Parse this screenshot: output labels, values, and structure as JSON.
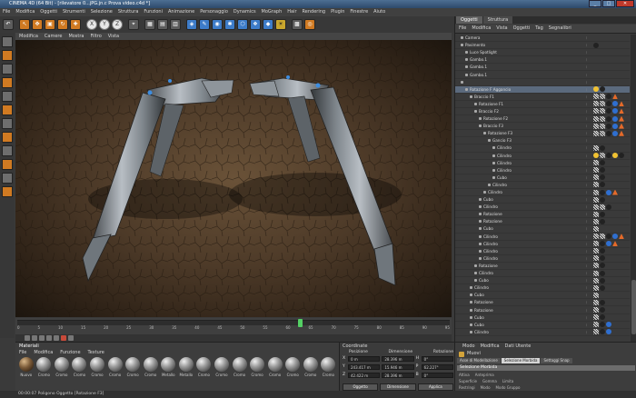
{
  "window": {
    "title": "CINEMA 4D (64 Bit) - [rilevatore 0...jPG.jn.c Prova video.c4d *]",
    "buttons": [
      "_",
      "□",
      "✕"
    ]
  },
  "menubar": [
    "File",
    "Modifica",
    "Oggetti",
    "Strumenti",
    "Selezione",
    "Struttura",
    "Funzioni",
    "Animazione",
    "Personaggio",
    "Dynamics",
    "MoGraph",
    "Hair",
    "Rendering",
    "Plugin",
    "Finestre",
    "Aiuto"
  ],
  "toolbar": {
    "axis_buttons": [
      "X",
      "Y",
      "Z"
    ]
  },
  "viewport": {
    "menu": [
      "Modifica",
      "Camere",
      "Mostra",
      "Filtro",
      "Vista"
    ]
  },
  "timeline": {
    "ticks": [
      "0",
      "5",
      "10",
      "15",
      "20",
      "25",
      "30",
      "35",
      "40",
      "45",
      "50",
      "55",
      "60",
      "65",
      "70",
      "75",
      "80",
      "85",
      "90",
      "95"
    ],
    "current_frame": 65,
    "max_frame": 100
  },
  "materials": {
    "title": "Materiali",
    "menu": [
      "File",
      "Modifica",
      "Funzione",
      "Texture"
    ],
    "items": [
      "Nuovo",
      "Cromo",
      "Cromo",
      "Cromo",
      "Cromo",
      "Cromo",
      "Cromo",
      "Cromo",
      "Metallo",
      "Metallo",
      "Cromo",
      "Cromo",
      "Cromo",
      "Cromo",
      "Cromo",
      "Cromo",
      "Cromo",
      "Cromo"
    ]
  },
  "coordinates": {
    "title": "Coordinate",
    "headers": [
      "Posizione",
      "Dimensione",
      "Rotazione"
    ],
    "rows": [
      {
        "axis": "X",
        "pos": "0 m",
        "dim": "28.396 m",
        "rlabel": "H",
        "rot": "0°"
      },
      {
        "axis": "Y",
        "pos": "243.417 m",
        "dim": "15.946 m",
        "rlabel": "P",
        "rot": "62.227°"
      },
      {
        "axis": "Z",
        "pos": "42.422 m",
        "dim": "28.396 m",
        "rlabel": "B",
        "rot": "0°"
      }
    ],
    "mode": "Oggetto",
    "size_mode": "Dimensione",
    "apply": "Applica"
  },
  "status": "00:00:07   Poligono Oggetto [Rotazione F3]",
  "object_manager": {
    "tabs": [
      "Oggetti",
      "Struttura"
    ],
    "menu": [
      "File",
      "Modifica",
      "Vista",
      "Oggetti",
      "Tag",
      "Segnalibri"
    ],
    "rows": [
      {
        "name": "Camera",
        "indent": 0,
        "tags": []
      },
      {
        "name": "Pavimento",
        "indent": 0,
        "tags": [
          "b"
        ]
      },
      {
        "name": "Luce Spotlight",
        "indent": 1,
        "tags": []
      },
      {
        "name": "Gambo.1",
        "indent": 1,
        "tags": []
      },
      {
        "name": "Gambo.1",
        "indent": 1,
        "tags": []
      },
      {
        "name": "Gambo.1",
        "indent": 1,
        "tags": []
      },
      {
        "name": "",
        "indent": 0,
        "tags": []
      },
      {
        "name": "Rotazione F Aggancio",
        "indent": 1,
        "tags": [
          "y",
          "b"
        ]
      },
      {
        "name": "Braccio F1",
        "indent": 2,
        "tags": [
          "c",
          "c",
          "b",
          "w"
        ]
      },
      {
        "name": "Rotazione F1",
        "indent": 3,
        "tags": [
          "c",
          "c",
          "b",
          "u",
          "w"
        ]
      },
      {
        "name": "Braccio F2",
        "indent": 3,
        "tags": [
          "c",
          "c",
          "b",
          "u",
          "w"
        ]
      },
      {
        "name": "Rotazione F2",
        "indent": 4,
        "tags": [
          "c",
          "c",
          "b",
          "u",
          "w"
        ]
      },
      {
        "name": "Braccio F3",
        "indent": 4,
        "tags": [
          "c",
          "c",
          "b",
          "u",
          "w"
        ]
      },
      {
        "name": "Rotazione F3",
        "indent": 5,
        "tags": [
          "c",
          "c",
          "b",
          "u",
          "w"
        ]
      },
      {
        "name": "Gancio F3",
        "indent": 6,
        "tags": []
      },
      {
        "name": "Cilindro",
        "indent": 7,
        "tags": [
          "c",
          "b"
        ]
      },
      {
        "name": "Cilindro",
        "indent": 7,
        "tags": [
          "y",
          "c",
          "b",
          "y",
          "b"
        ]
      },
      {
        "name": "Cilindro",
        "indent": 7,
        "tags": [
          "c",
          "b"
        ]
      },
      {
        "name": "Cilindro",
        "indent": 7,
        "tags": [
          "c",
          "b"
        ]
      },
      {
        "name": "Cubo",
        "indent": 7,
        "tags": [
          "c",
          "b"
        ]
      },
      {
        "name": "Cilindro",
        "indent": 6,
        "tags": [
          "c",
          "b"
        ]
      },
      {
        "name": "Cilindro",
        "indent": 5,
        "tags": [
          "c",
          "b",
          "u",
          "w"
        ]
      },
      {
        "name": "Cubo",
        "indent": 4,
        "tags": [
          "c",
          "b"
        ]
      },
      {
        "name": "Cilindro",
        "indent": 4,
        "tags": [
          "c",
          "c",
          "b"
        ]
      },
      {
        "name": "Rotazione",
        "indent": 4,
        "tags": [
          "c",
          "b"
        ]
      },
      {
        "name": "Rotazione",
        "indent": 4,
        "tags": [
          "c",
          "b"
        ]
      },
      {
        "name": "Cubo",
        "indent": 4,
        "tags": [
          "c"
        ]
      },
      {
        "name": "Cilindro",
        "indent": 4,
        "tags": [
          "c",
          "c",
          "b",
          "u",
          "w"
        ]
      },
      {
        "name": "Cilindro",
        "indent": 4,
        "tags": [
          "c",
          "b",
          "u",
          "w"
        ]
      },
      {
        "name": "Cilindro",
        "indent": 4,
        "tags": [
          "c",
          "b"
        ]
      },
      {
        "name": "Cilindro",
        "indent": 4,
        "tags": [
          "c",
          "b"
        ]
      },
      {
        "name": "Rotazione",
        "indent": 3,
        "tags": [
          "c",
          "b"
        ]
      },
      {
        "name": "Cilindro",
        "indent": 3,
        "tags": [
          "c",
          "b"
        ]
      },
      {
        "name": "Cubo",
        "indent": 3,
        "tags": [
          "c",
          "b"
        ]
      },
      {
        "name": "Cilindro",
        "indent": 2,
        "tags": [
          "c",
          "b"
        ]
      },
      {
        "name": "Cubo",
        "indent": 2,
        "tags": [
          "c"
        ]
      },
      {
        "name": "Rotazione",
        "indent": 2,
        "tags": [
          "c",
          "b"
        ]
      },
      {
        "name": "Rotazione",
        "indent": 2,
        "tags": [
          "c",
          "b"
        ]
      },
      {
        "name": "Cubo",
        "indent": 2,
        "tags": [
          "c",
          "b"
        ]
      },
      {
        "name": "Cubo",
        "indent": 2,
        "tags": [
          "c",
          "b",
          "u"
        ]
      },
      {
        "name": "Cilindro",
        "indent": 2,
        "tags": [
          "c",
          "b",
          "u"
        ]
      }
    ]
  },
  "attributes": {
    "menu": [
      "Modo",
      "Modifica",
      "Dati Utente"
    ],
    "object": "Muovi",
    "tabs": [
      "Asse di Modellazione",
      "Selezione Morbida",
      "Settaggi Snap"
    ],
    "active_tab": "Selezione Morbida",
    "header": "Selezione Morbida",
    "lines": [
      [
        "Attiva",
        "Anteprima"
      ],
      [
        "Superficie",
        "Gomma",
        "Limita"
      ],
      [
        "Restringi",
        "Modo",
        "Modo  Gruppo"
      ]
    ]
  },
  "colors": {
    "accent_orange": "#d07a22",
    "selection_blue": "#5b6a7d",
    "timeline_marker": "#54d064"
  }
}
